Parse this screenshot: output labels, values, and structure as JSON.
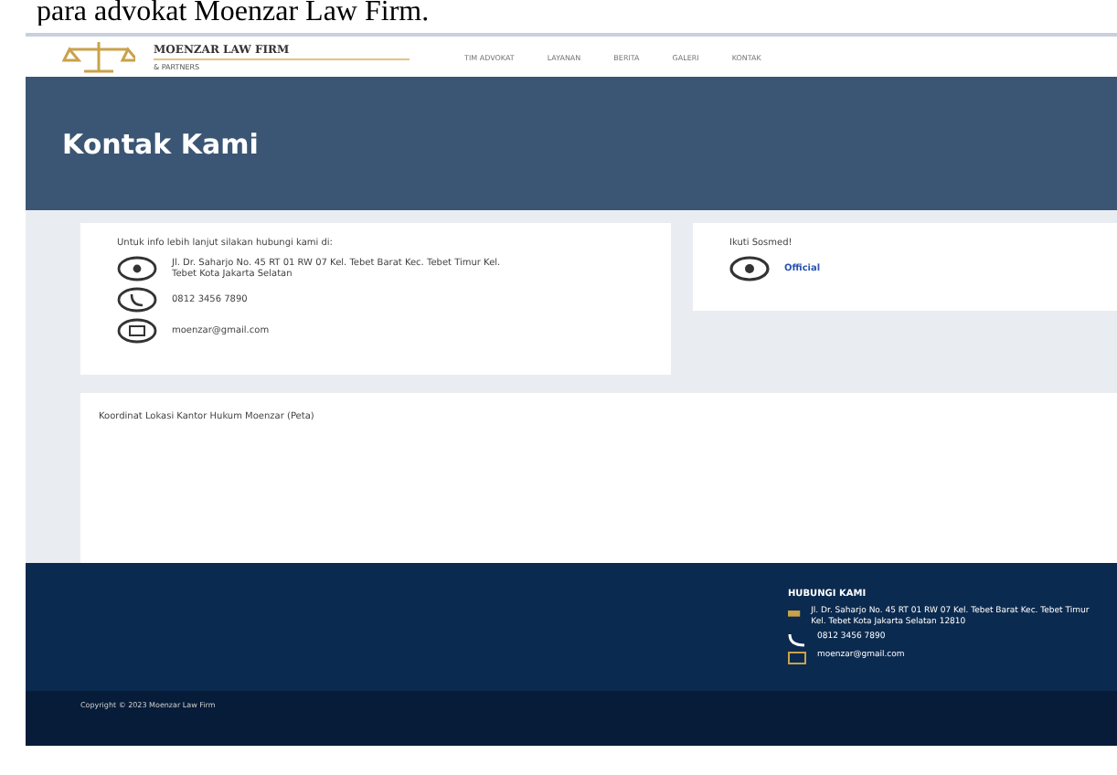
{
  "caption": "para advokat Moenzar Law Firm.",
  "header": {
    "brand": "MOENZAR LAW FIRM",
    "tagline": "& PARTNERS",
    "nav": [
      {
        "label": "TIM ADVOKAT",
        "selected": false
      },
      {
        "label": "LAYANAN",
        "selected": false
      },
      {
        "label": "BERITA",
        "selected": false
      },
      {
        "label": "GALERI",
        "selected": false
      },
      {
        "label": "KONTAK",
        "selected": false
      }
    ]
  },
  "banner": {
    "title": "Kontak Kami"
  },
  "contact_card": {
    "intro": "Untuk info lebih lanjut silakan hubungi kami di:",
    "items": [
      {
        "kind": "address",
        "text": "Jl. Dr. Saharjo No. 45 RT 01 RW 07 Kel. Tebet Barat Kec. Tebet Timur Kel. Tebet Kota Jakarta Selatan"
      },
      {
        "kind": "phone",
        "text": "0812 3456 7890"
      },
      {
        "kind": "email",
        "text": "moenzar@gmail.com"
      }
    ]
  },
  "social_card": {
    "title": "Ikuti Sosmed!",
    "link": "Official"
  },
  "map_card": {
    "title": "Koordinat Lokasi Kantor Hukum Moenzar (Peta)"
  },
  "footer": {
    "heading": "HUBUNGI KAMI",
    "items": [
      {
        "kind": "address",
        "text": "Jl. Dr. Saharjo No. 45 RT 01 RW 07 Kel. Tebet Barat Kec. Tebet Timur Kel. Tebet Kota Jakarta Selatan 12810"
      },
      {
        "kind": "phone",
        "text": "0812 3456 7890"
      },
      {
        "kind": "email",
        "text": "moenzar@gmail.com"
      }
    ],
    "copyright": "Copyright © 2023 Moenzar Law Firm"
  }
}
